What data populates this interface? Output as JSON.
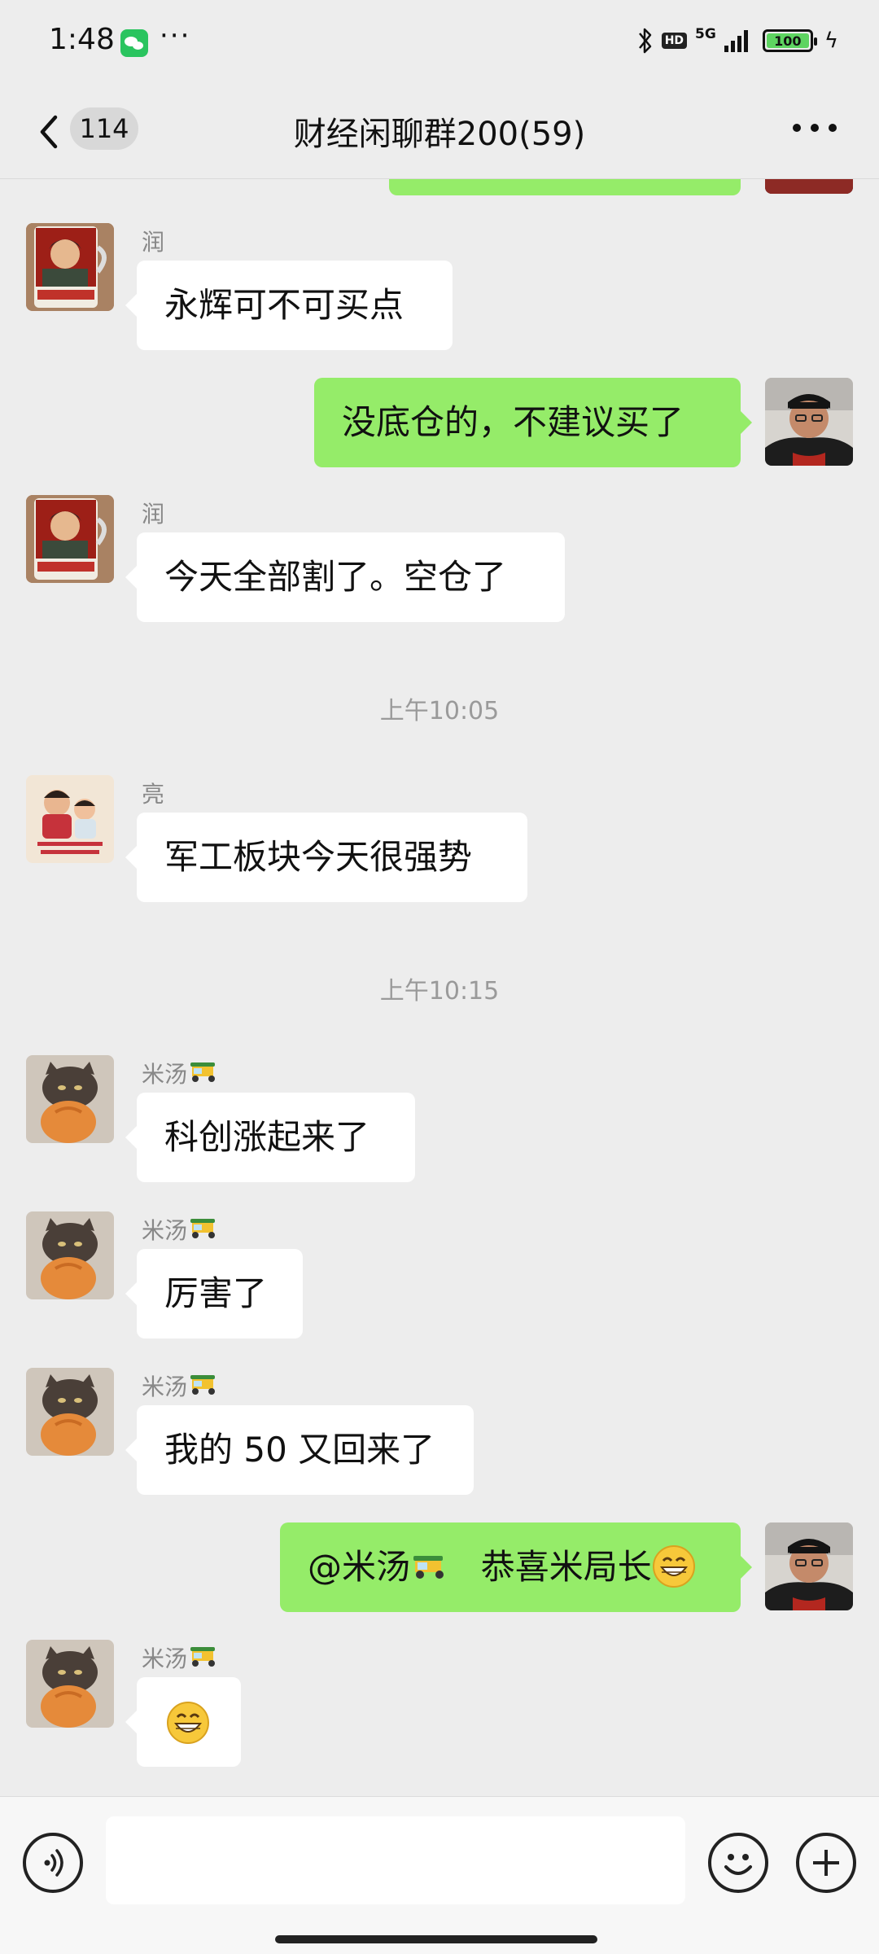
{
  "status_bar": {
    "time": "1:48",
    "dots": "···",
    "hd": "HD",
    "network": "5G",
    "battery": "100"
  },
  "nav": {
    "back_count": "114",
    "title": "财经闲聊群200(59)"
  },
  "messages": [
    {
      "side": "in",
      "sender": "润",
      "text": "永辉可不可买点"
    },
    {
      "side": "out",
      "text": "没底仓的，不建议买了"
    },
    {
      "side": "in",
      "sender": "润",
      "text": "今天全部割了。空仓了"
    },
    {
      "timestamp": "上午10:05"
    },
    {
      "side": "in",
      "sender": "亮",
      "text": "军工板块今天很强势"
    },
    {
      "timestamp": "上午10:15"
    },
    {
      "side": "in",
      "sender": "米汤",
      "text": "科创涨起来了"
    },
    {
      "side": "in",
      "sender": "米汤",
      "text": "厉害了"
    },
    {
      "side": "in",
      "sender": "米汤",
      "text": "我的 50 又回来了"
    },
    {
      "side": "out",
      "text_prefix": "@米汤",
      "text_suffix": "恭喜米局长"
    },
    {
      "side": "in",
      "sender": "米汤",
      "text": ""
    }
  ],
  "icons": {
    "back": "chevron-left-icon",
    "more": "more-dots-icon",
    "voice": "voice-icon",
    "emoji": "emoji-icon",
    "plus": "plus-icon",
    "rickshaw": "auto-rickshaw-emoji",
    "grin": "grinning-face-emoji"
  },
  "colors": {
    "background": "#ededed",
    "outgoing_bubble": "#95ec69",
    "incoming_bubble": "#ffffff",
    "input_bar": "#f7f7f7"
  }
}
